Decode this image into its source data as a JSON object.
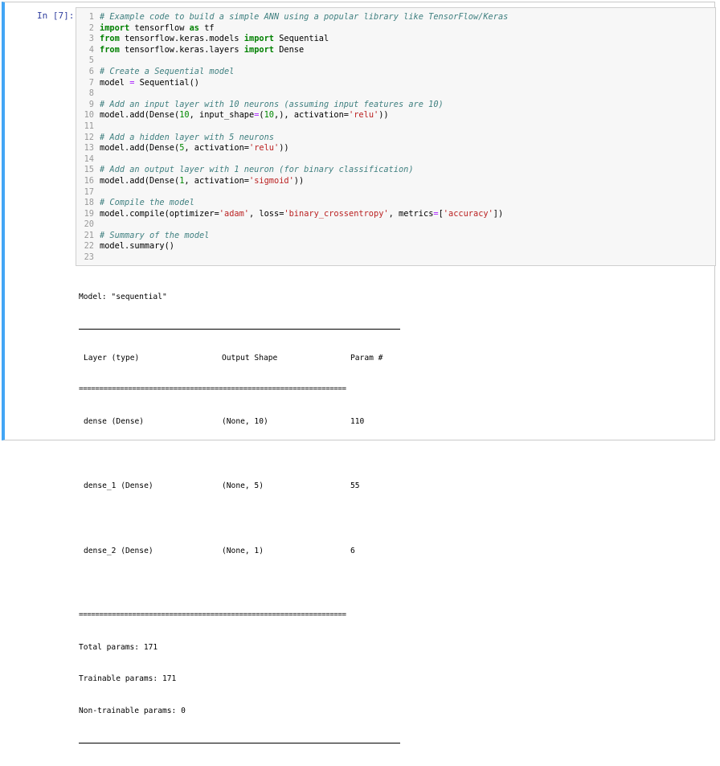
{
  "prompt": "In [7]:",
  "code": [
    {
      "n": "1",
      "t": "# Example code to build a simple ANN using a popular library like TensorFlow/Keras",
      "k": "cm"
    },
    {
      "n": "2",
      "t": "import tensorflow as tf",
      "k": "import"
    },
    {
      "n": "3",
      "t": "from tensorflow.keras.models import Sequential",
      "k": "from"
    },
    {
      "n": "4",
      "t": "from tensorflow.keras.layers import Dense",
      "k": "from"
    },
    {
      "n": "5",
      "t": "",
      "k": ""
    },
    {
      "n": "6",
      "t": "# Create a Sequential model",
      "k": "cm"
    },
    {
      "n": "7",
      "t": "model = Sequential()",
      "k": ""
    },
    {
      "n": "8",
      "t": "",
      "k": ""
    },
    {
      "n": "9",
      "t": "# Add an input layer with 10 neurons (assuming input features are 10)",
      "k": "cm"
    },
    {
      "n": "10",
      "t": "model.add(Dense(10, input_shape=(10,), activation='relu'))",
      "k": ""
    },
    {
      "n": "11",
      "t": "",
      "k": ""
    },
    {
      "n": "12",
      "t": "# Add a hidden layer with 5 neurons",
      "k": "cm"
    },
    {
      "n": "13",
      "t": "model.add(Dense(5, activation='relu'))",
      "k": ""
    },
    {
      "n": "14",
      "t": "",
      "k": ""
    },
    {
      "n": "15",
      "t": "# Add an output layer with 1 neuron (for binary classification)",
      "k": "cm"
    },
    {
      "n": "16",
      "t": "model.add(Dense(1, activation='sigmoid'))",
      "k": ""
    },
    {
      "n": "17",
      "t": "",
      "k": ""
    },
    {
      "n": "18",
      "t": "# Compile the model",
      "k": "cm"
    },
    {
      "n": "19",
      "t": "model.compile(optimizer='adam', loss='binary_crossentropy', metrics=['accuracy'])",
      "k": ""
    },
    {
      "n": "20",
      "t": "",
      "k": ""
    },
    {
      "n": "21",
      "t": "# Summary of the model",
      "k": "cm"
    },
    {
      "n": "22",
      "t": "model.summary()",
      "k": ""
    },
    {
      "n": "23",
      "t": "",
      "k": ""
    }
  ],
  "output": {
    "model_line": "Model: \"sequential\"",
    "header": {
      "layer": "Layer (type)",
      "shape": "Output Shape",
      "params": "Param #"
    },
    "eq_rule": "=================================================================",
    "rows": [
      {
        "layer": "dense (Dense)",
        "shape": "(None, 10)",
        "params": "110"
      },
      {
        "layer": "dense_1 (Dense)",
        "shape": "(None, 5)",
        "params": "55"
      },
      {
        "layer": "dense_2 (Dense)",
        "shape": "(None, 1)",
        "params": "6"
      }
    ],
    "total": "Total params: 171",
    "trainable": "Trainable params: 171",
    "non_trainable": "Non-trainable params: 0"
  }
}
